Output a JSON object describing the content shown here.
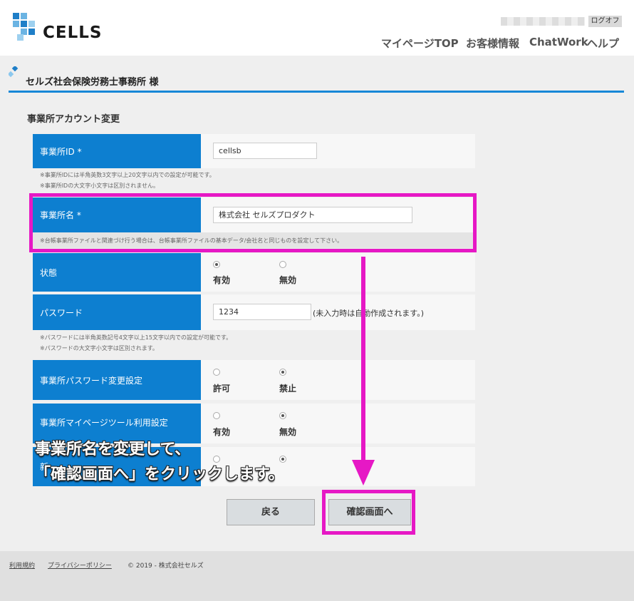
{
  "header": {
    "brand": "CELLS",
    "logout": "ログオフ",
    "nav": [
      "マイページTOP",
      "お客様情報",
      "ChatWork",
      "ヘルプ"
    ]
  },
  "office_name": "セルズ社会保険労務士事務所 様",
  "page_title": "事業所アカウント変更",
  "form": {
    "office_id": {
      "label": "事業所ID *",
      "value": "cellsb"
    },
    "office_id_notes": [
      "※事業所IDには半角英数3文字以上20文字以内での設定が可能です。",
      "※事業所IDの大文字小文字は区別されません。"
    ],
    "office_name": {
      "label": "事業所名 *",
      "value": "株式会社 セルズプロダクト",
      "note": "※台帳事業所ファイルと関連づけ行う場合は、台帳事業所ファイルの基本データ/会社名と同じものを設定して下さい。"
    },
    "status": {
      "label": "状態",
      "options": [
        "有効",
        "無効"
      ],
      "selected": 0
    },
    "password": {
      "label": "パスワード",
      "value": "1234",
      "hint": "(未入力時は自動作成されます。)"
    },
    "password_notes": [
      "※パスワードには半角英数記号4文字以上15文字以内での設定が可能です。",
      "※パスワードの大文字小文字は区別されます。"
    ],
    "pw_change": {
      "label": "事業所パスワード変更設定",
      "options": [
        "許可",
        "禁止"
      ],
      "selected": 1
    },
    "mypage_tool": {
      "label": "事業所マイページツール利用設定",
      "options": [
        "有効",
        "無効"
      ],
      "selected": 1
    },
    "row7": {
      "label": "新",
      "selected": 1
    }
  },
  "buttons": {
    "back": "戻る",
    "confirm": "確認画面へ"
  },
  "footer": {
    "terms": "利用規約",
    "privacy": "プライバシーポリシー",
    "copyright": "© 2019 - 株式会社セルズ"
  },
  "annotation": [
    "事業所名を変更して、",
    "「確認画面へ」をクリックします。"
  ],
  "colors": {
    "accent": "#0d7fd0",
    "highlight": "#e618c5"
  }
}
